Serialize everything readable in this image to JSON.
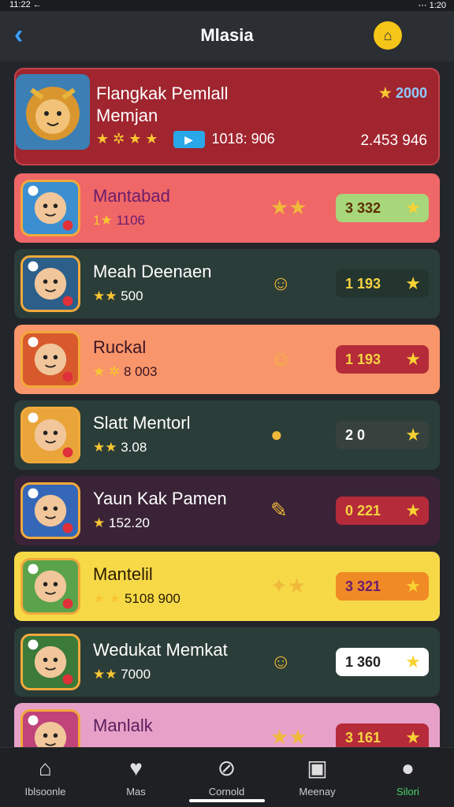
{
  "status": {
    "left": "11:22 ←",
    "right": "⋯ 1:20"
  },
  "header": {
    "title": "Mlasia",
    "back_icon": "back-arrow-icon",
    "profile_icon": "profile-badge-icon"
  },
  "featured": {
    "name_line1": "Flangkak Pemlall",
    "name_line2": "Memjan",
    "score": "2000",
    "stars": "★",
    "rating_stars": "★ ✲ ★ ★",
    "video_value": "1018: 906",
    "total": "2.453 946",
    "bg": "#a0252f"
  },
  "leaders": [
    {
      "name": "Mantabad",
      "stat_stars": "1★",
      "stat_value": "1106",
      "mid_icon": "★★",
      "pill_num": "3  332",
      "pill_icon": "★",
      "bg": "#f06767",
      "name_color": "#6a1d6d",
      "pill_bg": "#a8d67a",
      "pill_text": "#5b2f00"
    },
    {
      "name": "Meah Deenaen",
      "stat_stars": "★★",
      "stat_value": "500",
      "mid_icon": "☺",
      "pill_num": "1  193",
      "pill_icon": "★",
      "bg": "#2b3d38",
      "name_color": "#ffffff",
      "pill_bg": "#24352f",
      "pill_text": "#f5d342"
    },
    {
      "name": "Ruckal",
      "stat_stars": "★ ✲",
      "stat_value": "8 003",
      "mid_icon": "☺",
      "pill_num": "1  193",
      "pill_icon": "★",
      "bg": "#f9956a",
      "name_color": "#3a1424",
      "pill_bg": "#b52b3a",
      "pill_text": "#f5d342"
    },
    {
      "name": "Slatt Mentorl",
      "stat_stars": "★★",
      "stat_value": "3.08",
      "mid_icon": "●",
      "pill_num": "2  0",
      "pill_icon": "★",
      "bg": "#2b3d38",
      "name_color": "#ffffff",
      "pill_bg": "#37413d",
      "pill_text": "#ffffff"
    },
    {
      "name": "Yaun Kak Pamen",
      "stat_stars": "★",
      "stat_value": "152.20",
      "mid_icon": "✎",
      "pill_num": "0  221",
      "pill_icon": "★",
      "bg": "#3a2336",
      "name_color": "#ffffff",
      "pill_bg": "#b52b3a",
      "pill_text": "#f5d342"
    },
    {
      "name": "Mantelil",
      "stat_stars": "★ ★",
      "stat_value": "5108 900",
      "mid_icon": "✦★",
      "pill_num": "3  321",
      "pill_icon": "★",
      "bg": "#f7d948",
      "name_color": "#2a1b00",
      "pill_bg": "#f08a25",
      "pill_text": "#6a1d6d"
    },
    {
      "name": "Wedukat Memkat",
      "stat_stars": "★★",
      "stat_value": "7000",
      "mid_icon": "☺",
      "pill_num": "1  360",
      "pill_icon": "★",
      "bg": "#2b3d38",
      "name_color": "#ffffff",
      "pill_bg": "#ffffff",
      "pill_text": "#222222"
    },
    {
      "name": "Manlalk",
      "stat_stars": "",
      "stat_value": "",
      "mid_icon": "★★",
      "pill_num": "3  161",
      "pill_icon": "★",
      "bg": "#e7a1c8",
      "name_color": "#5b1f5e",
      "pill_bg": "#b52b3a",
      "pill_text": "#f5d342"
    }
  ],
  "nav": [
    {
      "label": "Iblsoonle",
      "icon": "⌂"
    },
    {
      "label": "Mas",
      "icon": "♥"
    },
    {
      "label": "Cornold",
      "icon": "⊘"
    },
    {
      "label": "Meenay",
      "icon": "▣"
    },
    {
      "label": "Silori",
      "icon": "●"
    }
  ]
}
